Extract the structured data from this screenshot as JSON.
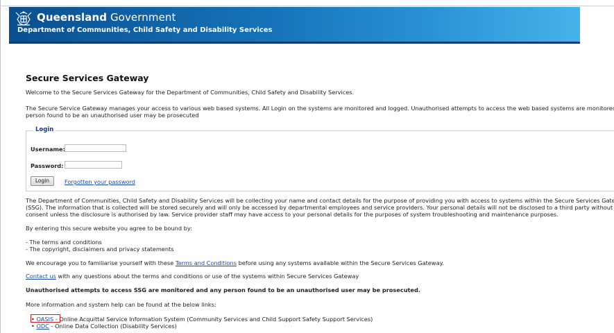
{
  "header": {
    "gov_name_strong": "Queensland",
    "gov_name_rest": " Government",
    "department": "Department of Communities, Child Safety and Disability Services",
    "crest_icon": "queensland-crest-icon",
    "colors": {
      "banner_start": "#0a4f8e",
      "banner_end": "#46b3ea"
    }
  },
  "page": {
    "title": "Secure Services Gateway",
    "welcome": "Welcome to the Secure Services Gateway for the Department of Communities, Child Safety and Disability Services.",
    "notice_line1": "The Secure Service Gateway manages your access to various web based systems. All Login on the systems are monitored and logged. Unauthorised attempts to access the web based systems are monitored. Any",
    "notice_line2": "person found to be an unauthorised user may be prosecuted"
  },
  "login": {
    "legend": "Login",
    "username_label": "Username:",
    "username_value": "",
    "password_label": "Password:",
    "password_value": "",
    "login_button": "Login",
    "forgot_link": "Forgotten your password"
  },
  "privacy": {
    "line1": "The Department of Communities, Child Safety and Disability Services will be collecting your name and contact details for the purpose of providing you with access to systems within the Secure Services Gateway",
    "line2": "(SSG). The information that is collected will be stored securely and will only be accessed by departmental employees and service providers. Your personal details will not be disclosed to a third party without your",
    "line3": "consent unless the disclosure is authorised by law. Service provider staff may have access to your personal details for the purposes of system troubleshooting and maintenance purposes."
  },
  "agreement": {
    "intro": "By entering this secure website you agree to be bound by:",
    "item1": "- The terms and conditions",
    "item2": "- The copyright, disclaimers and privacy statements"
  },
  "encourage": {
    "before": "We encourage you to familiarise yourself with these ",
    "link": "Terms and Conditions",
    "after": " before using any systems available within the Secure Services Gateway."
  },
  "contact": {
    "link": "Contact us",
    "after": " with any questions about the terms and conditions or use of the systems within Secure Services Gateway"
  },
  "warning": "Unauthorised attempts to access SSG are monitored and any person found to be an unauthorised user may be prosecuted.",
  "more_info": "More information and system help can be found at the below links:",
  "links": [
    {
      "name": "OASIS",
      "desc": " - Online Acquittal Service Information System (Community Services and Child Support Safety Support Services)"
    },
    {
      "name": "ODC",
      "desc": " - Online Data Collection (Disability Services)"
    }
  ],
  "highlight_color": "#d8171d"
}
